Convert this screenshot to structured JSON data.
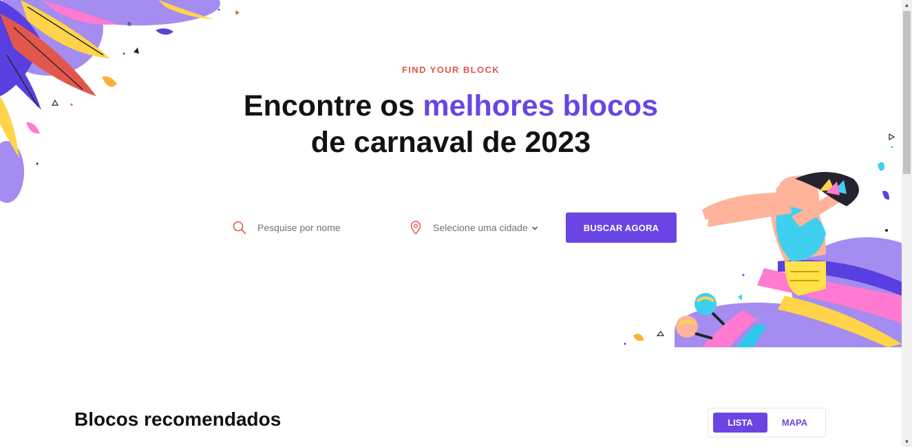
{
  "hero": {
    "eyebrow": "FIND YOUR BLOCK",
    "title_part1": "Encontre os ",
    "title_highlight": "melhores blocos",
    "title_line2": "de carnaval de 2023"
  },
  "search": {
    "placeholder": "Pesquise por nome",
    "city_placeholder": "Selecione uma cidade",
    "button_label": "BUSCAR AGORA"
  },
  "section": {
    "title": "Blocos recomendados",
    "toggle": [
      {
        "label": "LISTA",
        "active": true
      },
      {
        "label": "MAPA",
        "active": false
      }
    ]
  },
  "colors": {
    "primary": "#6a45e4",
    "accent": "#e2574c",
    "text": "#121212"
  },
  "icons": {
    "search": "search-icon",
    "location": "map-pin-icon",
    "dropdown": "chevron-down-icon"
  }
}
